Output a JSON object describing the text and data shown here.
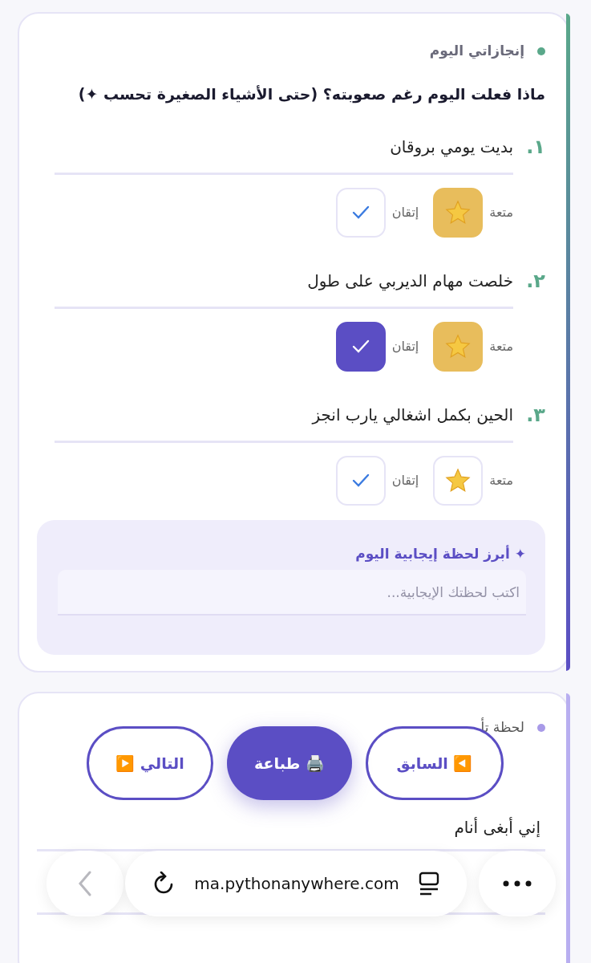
{
  "achievements_card": {
    "section_label": "إنجازاتي اليوم",
    "question": "ماذا فعلت اليوم رغم صعوبته؟ (حتى الأشياء الصغيرة تحسب ✦)",
    "items": [
      {
        "number": "١.",
        "text": "بديت يومي بروقان",
        "fun_label": "متعة",
        "fun": true,
        "mastery_label": "إتقان",
        "mastery": false
      },
      {
        "number": "٢.",
        "text": "خلصت مهام الديربي على طول",
        "fun_label": "متعة",
        "fun": true,
        "mastery_label": "إتقان",
        "mastery": true
      },
      {
        "number": "٣.",
        "text": "الحين بكمل اشغالي يارب انجز",
        "fun_label": "متعة",
        "fun": false,
        "mastery_label": "إتقان",
        "mastery": false
      }
    ],
    "highlight": {
      "title": "✦ أبرز لحظة إيجابية اليوم",
      "placeholder": "اكتب لحظتك الإيجابية..."
    }
  },
  "reflection_card": {
    "section_label": "لحظة تأ",
    "answer": "إني أبغى أنام"
  },
  "nav_buttons": [
    {
      "kind": "outline",
      "label": "◀️ السابق"
    },
    {
      "kind": "filled",
      "label": "🖨️ طباعة"
    },
    {
      "kind": "outline",
      "label": "التالي ▶️"
    }
  ],
  "browser_bar": {
    "url": "ma.pythonanywhere.com"
  }
}
